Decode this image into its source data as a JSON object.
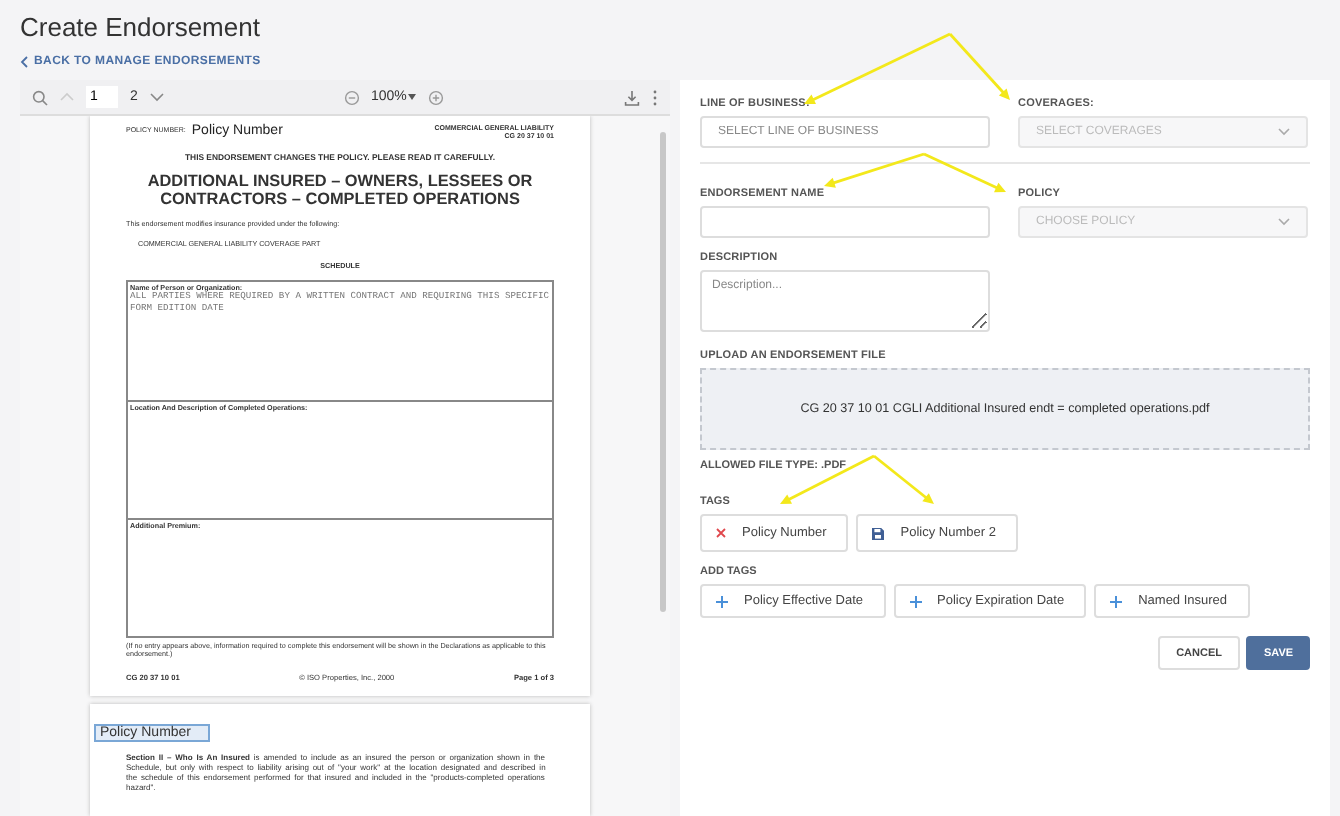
{
  "page_title": "Create Endorsement",
  "back_link": "BACK TO MANAGE ENDORSEMENTS",
  "viewer": {
    "page_input": "1",
    "page_total": "2",
    "zoom": "100%"
  },
  "document": {
    "policy_number_label": "POLICY NUMBER:",
    "policy_number_field": "Policy Number",
    "form_line": "COMMERCIAL GENERAL LIABILITY",
    "form_code": "CG 20 37 10 01",
    "notice": "THIS ENDORSEMENT CHANGES THE POLICY.  PLEASE READ IT CAREFULLY.",
    "title": "ADDITIONAL INSURED – OWNERS, LESSEES OR CONTRACTORS – COMPLETED OPERATIONS",
    "intro": "This endorsement modifies insurance provided under the following:",
    "coverage_part": "COMMERCIAL GENERAL LIABILITY COVERAGE PART",
    "schedule_heading": "SCHEDULE",
    "schedule": [
      {
        "label": "Name of Person or Organization:",
        "value": "ALL PARTIES WHERE REQUIRED BY A WRITTEN CONTRACT AND REQUIRING THIS SPECIFIC FORM EDITION DATE"
      },
      {
        "label": "Location And Description of Completed Operations:"
      },
      {
        "label": "Additional Premium:"
      }
    ],
    "footnote": "(If no entry appears above, information required to complete this endorsement will be shown in the Declarations as applicable to this endorsement.)",
    "footer": [
      "CG 20 37 10 01",
      "© ISO Properties, Inc., 2000",
      "Page 1 of 3"
    ],
    "page2_field": "Policy Number",
    "page2_text": "**Section II – Who Is An Insured** is amended to include as an insured the person or organization shown in the Schedule, but only with respect to liability arising out of \"your work\" at the location designated and described in the schedule of this endorsement performed for that insured and included in the \"products-completed operations hazard\"."
  },
  "form": {
    "rows": [
      [
        {
          "label": "LINE OF BUSINESS:",
          "kind": "input",
          "placeholder": "SELECT LINE OF BUSINESS",
          "disabled": false
        },
        {
          "label": "COVERAGES:",
          "kind": "select",
          "placeholder": "SELECT COVERAGES",
          "disabled": true
        }
      ],
      [
        {
          "label": "ENDORSEMENT NAME",
          "kind": "input",
          "disabled": false
        },
        {
          "label": "POLICY",
          "kind": "select",
          "placeholder": "CHOOSE POLICY",
          "disabled": true
        }
      ],
      [
        {
          "label": "DESCRIPTION",
          "kind": "textarea",
          "placeholder": "Description...",
          "disabled": false
        }
      ]
    ],
    "upload_label": "UPLOAD AN ENDORSEMENT FILE",
    "upload_file": "CG 20 37 10 01 CGLI Additional Insured endt = completed operations.pdf",
    "allowed_type": "ALLOWED FILE TYPE: .PDF",
    "tags_label": "TAGS",
    "tags": [
      {
        "kind": "remove",
        "label": "Policy Number"
      },
      {
        "kind": "saved",
        "label": "Policy Number 2"
      }
    ],
    "add_tags_label": "ADD TAGS",
    "add_tags": [
      "Policy Effective Date",
      "Policy Expiration Date",
      "Named Insured"
    ],
    "buttons": [
      {
        "kind": "secondary",
        "label": "CANCEL"
      },
      {
        "kind": "primary",
        "label": "SAVE"
      }
    ]
  }
}
